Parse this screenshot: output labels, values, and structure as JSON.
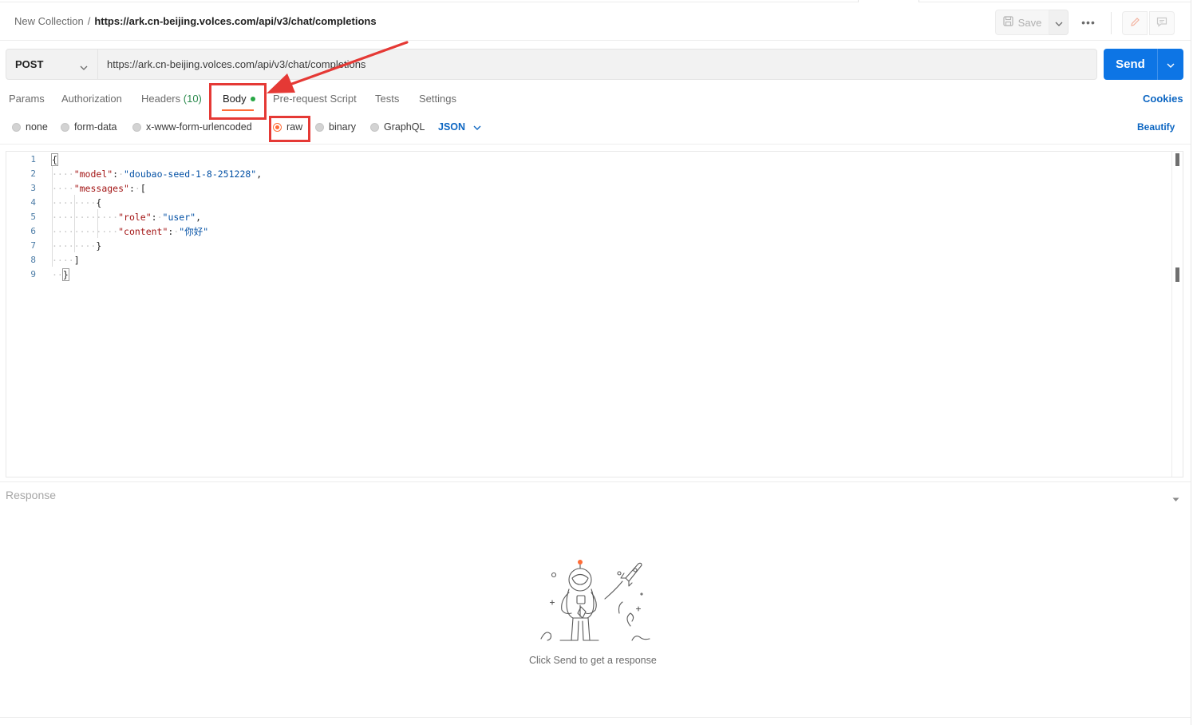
{
  "header": {
    "breadcrumb_parent": "New Collection",
    "breadcrumb_sep": "/",
    "breadcrumb_current": "https://ark.cn-beijing.volces.com/api/v3/chat/completions",
    "save_label": "Save",
    "more_label": "•••"
  },
  "request": {
    "method": "POST",
    "url": "https://ark.cn-beijing.volces.com/api/v3/chat/completions",
    "send_label": "Send"
  },
  "tabs": {
    "params": "Params",
    "authorization": "Authorization",
    "headers": "Headers",
    "headers_count": "(10)",
    "body": "Body",
    "prerequest": "Pre-request Script",
    "tests": "Tests",
    "settings": "Settings",
    "cookies": "Cookies"
  },
  "body_types": {
    "none": "none",
    "form_data": "form-data",
    "urlencoded": "x-www-form-urlencoded",
    "raw": "raw",
    "binary": "binary",
    "graphql": "GraphQL",
    "selected": "raw",
    "format": "JSON",
    "beautify": "Beautify"
  },
  "editor": {
    "line_numbers": [
      "1",
      "2",
      "3",
      "4",
      "5",
      "6",
      "7",
      "8",
      "9"
    ],
    "model_key": "\"model\"",
    "model_value": "\"doubao-seed-1-8-251228\"",
    "messages_key": "\"messages\"",
    "role_key": "\"role\"",
    "role_value": "\"user\"",
    "content_key": "\"content\"",
    "content_value": "\"你好\""
  },
  "response": {
    "title": "Response",
    "empty_message": "Click Send to get a response"
  },
  "colors": {
    "accent": "#ff6c37",
    "send_button": "#0d75e5",
    "link": "#0d66c2",
    "annotation": "#e53935"
  },
  "icons": [
    "save-icon",
    "chevron-down-icon",
    "more-icon",
    "pencil-icon",
    "comment-icon",
    "astronaut-illustration"
  ]
}
